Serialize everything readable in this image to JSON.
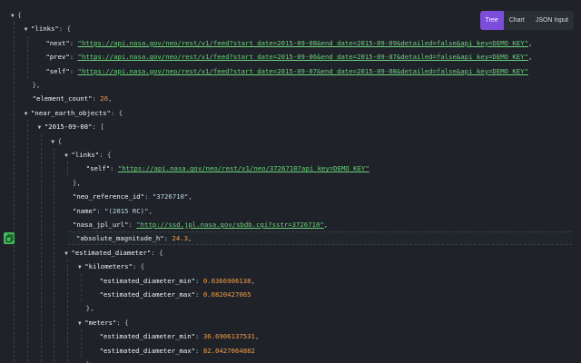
{
  "toolbar": {
    "tree_label": "Tree",
    "chart_label": "Chart",
    "json_input_label": "JSON Input",
    "active_tab": "Tree",
    "accent_color": "#7c4ddb"
  },
  "copy_button": {
    "icon": "copy-icon",
    "color": "#42b75a"
  },
  "json_lines": [
    {
      "depth": 0,
      "arrow": true,
      "parts": [
        [
          "punc",
          "{"
        ]
      ]
    },
    {
      "depth": 1,
      "arrow": true,
      "parts": [
        [
          "key",
          "\"links\""
        ],
        [
          "punc",
          ": {"
        ]
      ]
    },
    {
      "depth": 2,
      "arrow": false,
      "parts": [
        [
          "key",
          "\"next\""
        ],
        [
          "punc",
          ": "
        ],
        [
          "url",
          "\"https://api.nasa.gov/neo/rest/v1/feed?start_date=2015-09-08&end_date=2015-09-09&detailed=false&api_key=DEMO_KEY\""
        ],
        [
          "punc",
          ","
        ]
      ]
    },
    {
      "depth": 2,
      "arrow": false,
      "parts": [
        [
          "key",
          "\"prev\""
        ],
        [
          "punc",
          ": "
        ],
        [
          "url",
          "\"https://api.nasa.gov/neo/rest/v1/feed?start_date=2015-09-06&end_date=2015-09-07&detailed=false&api_key=DEMO_KEY\""
        ],
        [
          "punc",
          ","
        ]
      ]
    },
    {
      "depth": 2,
      "arrow": false,
      "parts": [
        [
          "key",
          "\"self\""
        ],
        [
          "punc",
          ": "
        ],
        [
          "url",
          "\"https://api.nasa.gov/neo/rest/v1/feed?start_date=2015-09-07&end_date=2015-09-08&detailed=false&api_key=DEMO_KEY\""
        ]
      ]
    },
    {
      "depth": 1,
      "arrow": false,
      "parts": [
        [
          "punc",
          "},"
        ]
      ]
    },
    {
      "depth": 1,
      "arrow": false,
      "parts": [
        [
          "key",
          "\"element_count\""
        ],
        [
          "punc",
          ": "
        ],
        [
          "num",
          "26"
        ],
        [
          "punc",
          ","
        ]
      ]
    },
    {
      "depth": 1,
      "arrow": true,
      "parts": [
        [
          "key",
          "\"near_earth_objects\""
        ],
        [
          "punc",
          ": {"
        ]
      ]
    },
    {
      "depth": 2,
      "arrow": true,
      "parts": [
        [
          "key",
          "\"2015-09-08\""
        ],
        [
          "punc",
          ": ["
        ]
      ]
    },
    {
      "depth": 3,
      "arrow": true,
      "parts": [
        [
          "punc",
          "{"
        ]
      ]
    },
    {
      "depth": 4,
      "arrow": true,
      "parts": [
        [
          "key",
          "\"links\""
        ],
        [
          "punc",
          ": {"
        ]
      ]
    },
    {
      "depth": 5,
      "arrow": false,
      "parts": [
        [
          "key",
          "\"self\""
        ],
        [
          "punc",
          ": "
        ],
        [
          "url",
          "\"https://api.nasa.gov/neo/rest/v1/neo/3726710?api_key=DEMO_KEY\""
        ]
      ]
    },
    {
      "depth": 4,
      "arrow": false,
      "parts": [
        [
          "punc",
          "},"
        ]
      ]
    },
    {
      "depth": 4,
      "arrow": false,
      "parts": [
        [
          "key",
          "\"neo_reference_id\""
        ],
        [
          "punc",
          ": "
        ],
        [
          "str",
          "\"3726710\""
        ],
        [
          "punc",
          ","
        ]
      ]
    },
    {
      "depth": 4,
      "arrow": false,
      "parts": [
        [
          "key",
          "\"name\""
        ],
        [
          "punc",
          ": "
        ],
        [
          "str",
          "\"(2015 RC)\""
        ],
        [
          "punc",
          ","
        ]
      ]
    },
    {
      "depth": 4,
      "arrow": false,
      "parts": [
        [
          "key",
          "\"nasa_jpl_url\""
        ],
        [
          "punc",
          ": "
        ],
        [
          "url",
          "\"http://ssd.jpl.nasa.gov/sbdb.cgi?sstr=3726710\""
        ],
        [
          "punc",
          ","
        ]
      ]
    },
    {
      "depth": 4,
      "arrow": false,
      "hl": true,
      "parts": [
        [
          "key",
          "\"absolute_magnitude_h\""
        ],
        [
          "punc",
          ": "
        ],
        [
          "num",
          "24.3"
        ],
        [
          "punc",
          ","
        ]
      ]
    },
    {
      "depth": 4,
      "arrow": true,
      "parts": [
        [
          "key",
          "\"estimated_diameter\""
        ],
        [
          "punc",
          ": {"
        ]
      ]
    },
    {
      "depth": 5,
      "arrow": true,
      "parts": [
        [
          "key",
          "\"kilometers\""
        ],
        [
          "punc",
          ": {"
        ]
      ]
    },
    {
      "depth": 6,
      "arrow": false,
      "parts": [
        [
          "key",
          "\"estimated_diameter_min\""
        ],
        [
          "punc",
          ": "
        ],
        [
          "num",
          "0.0366906138"
        ],
        [
          "punc",
          ","
        ]
      ]
    },
    {
      "depth": 6,
      "arrow": false,
      "parts": [
        [
          "key",
          "\"estimated_diameter_max\""
        ],
        [
          "punc",
          ": "
        ],
        [
          "num",
          "0.0820427065"
        ]
      ]
    },
    {
      "depth": 5,
      "arrow": false,
      "parts": [
        [
          "punc",
          "},"
        ]
      ]
    },
    {
      "depth": 5,
      "arrow": true,
      "parts": [
        [
          "key",
          "\"meters\""
        ],
        [
          "punc",
          ": {"
        ]
      ]
    },
    {
      "depth": 6,
      "arrow": false,
      "parts": [
        [
          "key",
          "\"estimated_diameter_min\""
        ],
        [
          "punc",
          ": "
        ],
        [
          "num",
          "36.6906137531"
        ],
        [
          "punc",
          ","
        ]
      ]
    },
    {
      "depth": 6,
      "arrow": false,
      "parts": [
        [
          "key",
          "\"estimated_diameter_max\""
        ],
        [
          "punc",
          ": "
        ],
        [
          "num",
          "82.0427064882"
        ]
      ]
    },
    {
      "depth": 5,
      "arrow": false,
      "parts": [
        [
          "punc",
          "}"
        ]
      ]
    }
  ]
}
